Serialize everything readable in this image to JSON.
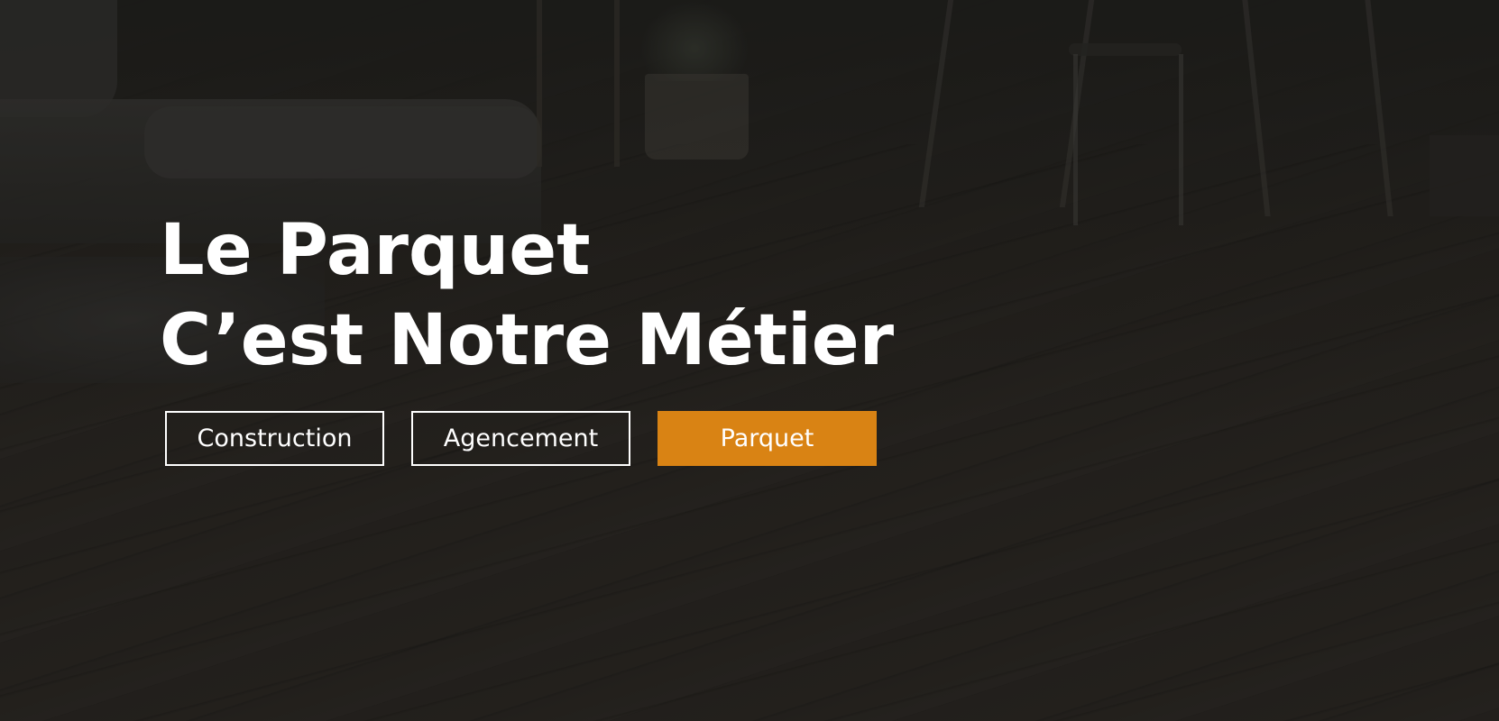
{
  "hero": {
    "headline_line1": "Le Parquet",
    "headline_line2": "C’est Notre Métier",
    "background_image": "dark living room with wooden parquet floor, sofa, plant and stools"
  },
  "buttons": [
    {
      "label": "Construction",
      "style": "outline"
    },
    {
      "label": "Agencement",
      "style": "outline"
    },
    {
      "label": "Parquet",
      "style": "filled"
    }
  ],
  "colors": {
    "accent": "#d98314",
    "text": "#ffffff",
    "background": "#27241f"
  }
}
